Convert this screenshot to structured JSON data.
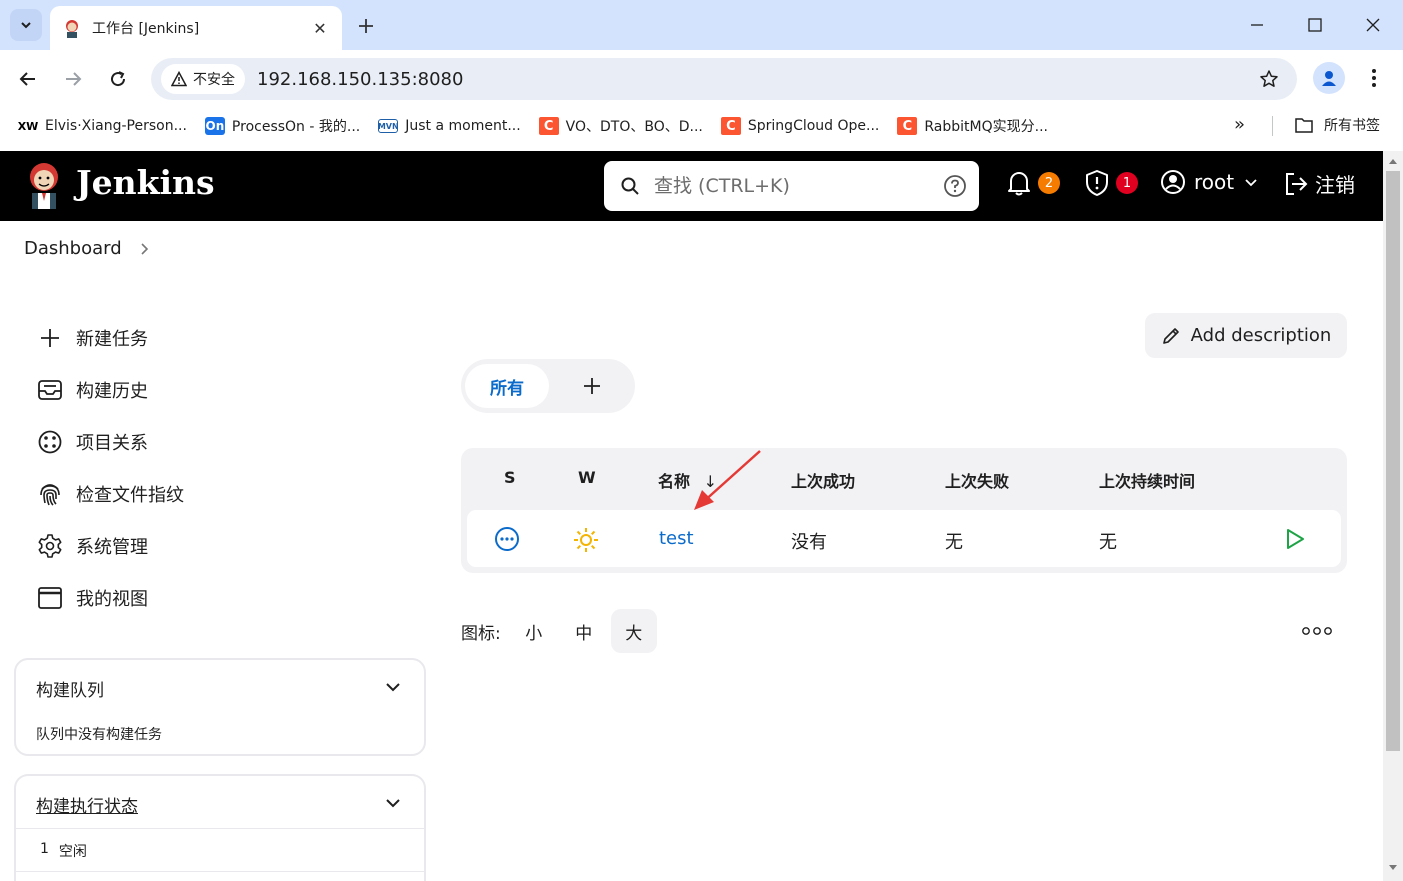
{
  "browser": {
    "tab_title": "工作台 [Jenkins]",
    "security_label": "不安全",
    "url": "192.168.150.135:8080",
    "bookmarks": [
      {
        "icon": "XW",
        "label": "Elvis·Xiang-Person..."
      },
      {
        "icon": "On",
        "label": "ProcessOn - 我的..."
      },
      {
        "icon": "MVN",
        "label": "Just a moment..."
      },
      {
        "icon": "C",
        "label": "VO、DTO、BO、D..."
      },
      {
        "icon": "C",
        "label": "SpringCloud Ope..."
      },
      {
        "icon": "C",
        "label": "RabbitMQ实现分..."
      }
    ],
    "bookmarks_more": "»",
    "all_bookmarks": "所有书签"
  },
  "header": {
    "brand": "Jenkins",
    "search_placeholder": "查找 (CTRL+K)",
    "notifications_count": "2",
    "security_count": "1",
    "user": "root",
    "logout": "注销"
  },
  "breadcrumb": {
    "dashboard": "Dashboard"
  },
  "sidebar": {
    "tasks": [
      {
        "label": "新建任务",
        "icon": "plus-icon"
      },
      {
        "label": "构建历史",
        "icon": "inbox-icon"
      },
      {
        "label": "项目关系",
        "icon": "relationship-icon"
      },
      {
        "label": "检查文件指纹",
        "icon": "fingerprint-icon"
      },
      {
        "label": "系统管理",
        "icon": "gear-icon"
      },
      {
        "label": "我的视图",
        "icon": "window-icon"
      }
    ],
    "queue": {
      "title": "构建队列",
      "empty": "队列中没有构建任务"
    },
    "executors": {
      "title": "构建执行状态",
      "items": [
        {
          "num": "1",
          "status": "空闲"
        }
      ]
    }
  },
  "main": {
    "add_description": "Add description",
    "view_tabs": {
      "active": "所有"
    },
    "table": {
      "headers": {
        "s": "S",
        "w": "W",
        "name": "名称",
        "sort_arrow": "↓",
        "last_success": "上次成功",
        "last_failure": "上次失败",
        "last_duration": "上次持续时间"
      },
      "rows": [
        {
          "name": "test",
          "last_success": "没有",
          "last_failure": "无",
          "last_duration": "无"
        }
      ]
    },
    "icon_size": {
      "label": "图标:",
      "options": [
        "小",
        "中",
        "大"
      ],
      "active": "大"
    }
  },
  "colors": {
    "accent": "#0b6bcb",
    "notification_badge": "#f57c00",
    "security_badge": "#e00020",
    "run_button": "#1ea446",
    "weather_sun": "#f4b400"
  }
}
